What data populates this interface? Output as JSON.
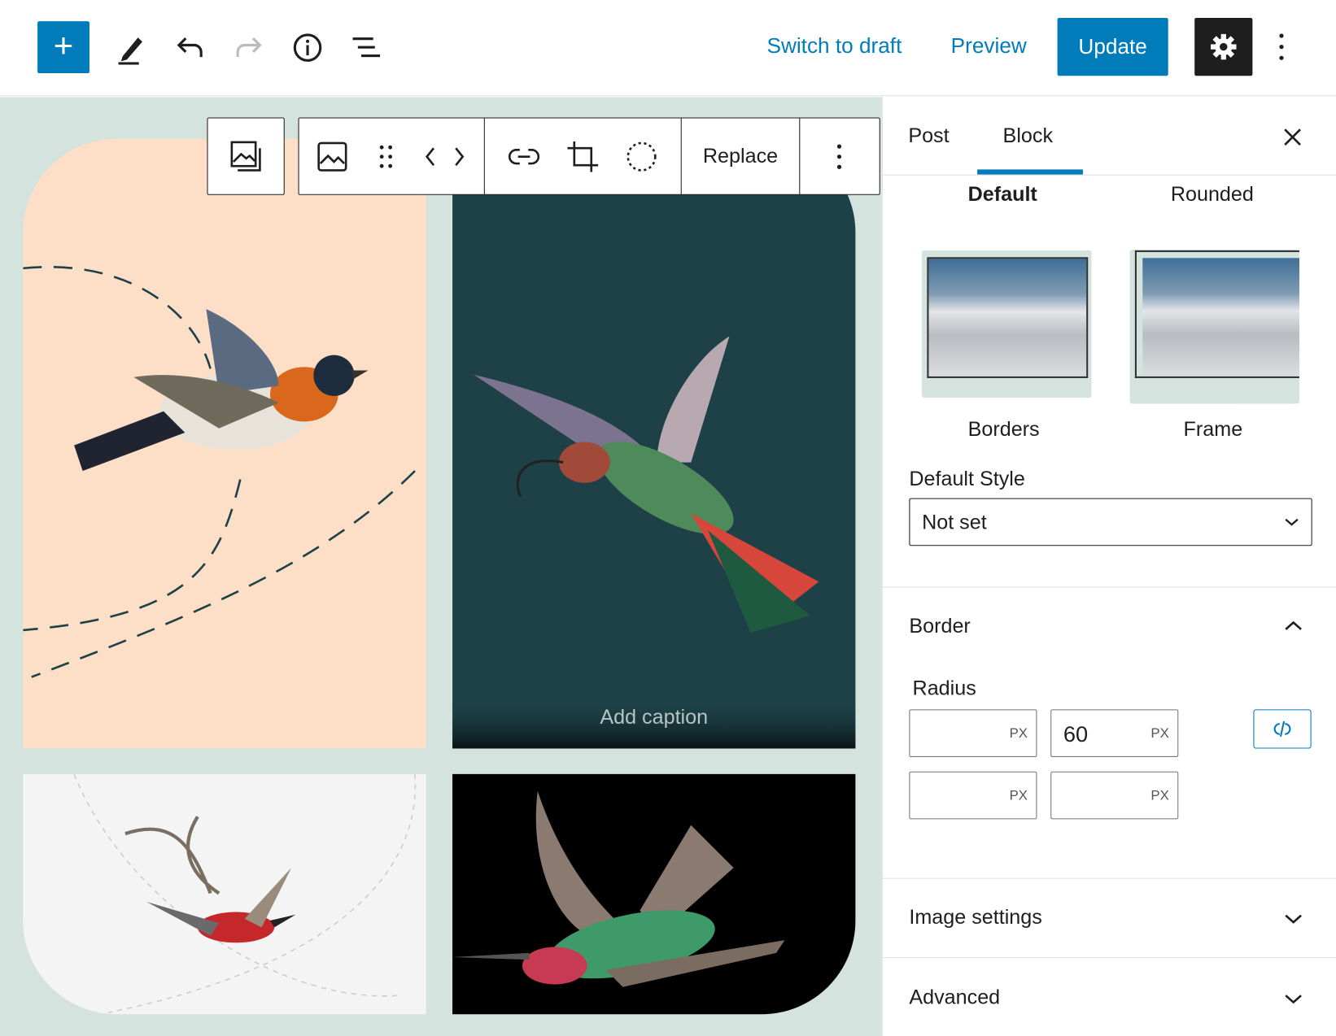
{
  "topbar": {
    "switch_to_draft": "Switch to draft",
    "preview": "Preview",
    "update": "Update"
  },
  "block_toolbar": {
    "replace": "Replace"
  },
  "canvas": {
    "caption_placeholder": "Add caption"
  },
  "sidebar": {
    "tabs": [
      {
        "label": "Post",
        "active": false
      },
      {
        "label": "Block",
        "active": true
      }
    ],
    "styles": {
      "default": "Default",
      "rounded": "Rounded",
      "borders": "Borders",
      "frame": "Frame"
    },
    "default_style": {
      "label": "Default Style",
      "value": "Not set"
    },
    "border": {
      "title": "Border",
      "radius_label": "Radius",
      "unit": "PX",
      "values": [
        "",
        "60",
        "",
        ""
      ]
    },
    "image_settings": "Image settings",
    "advanced": "Advanced"
  },
  "colors": {
    "accent": "#007cba",
    "canvas_bg": "#d4e3dd",
    "peach": "#fddfc8",
    "teal": "#1d4147"
  }
}
